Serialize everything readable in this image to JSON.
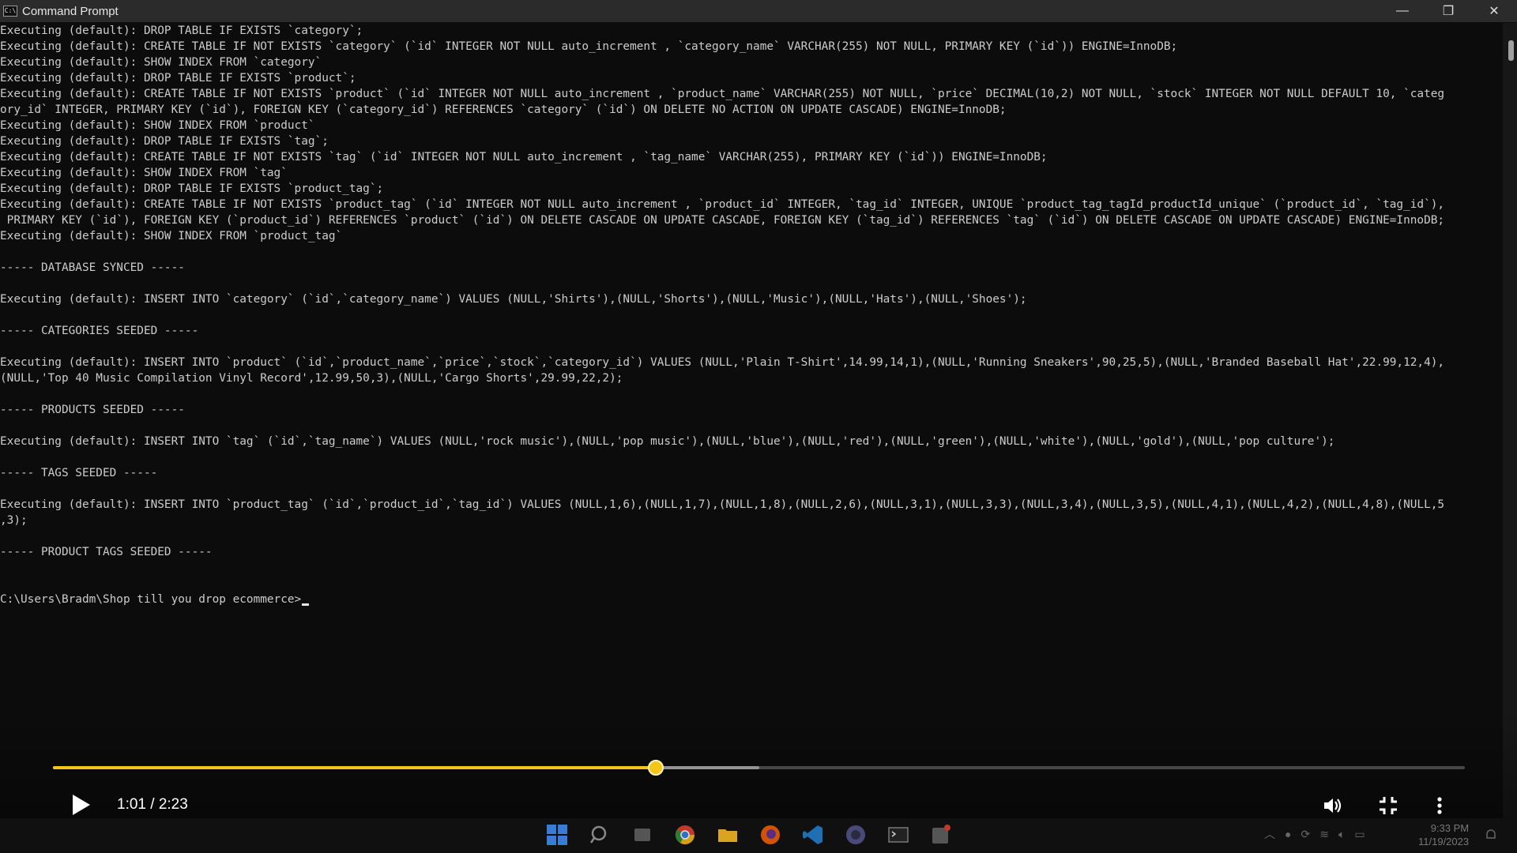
{
  "window": {
    "title": "Command Prompt",
    "icon_text": "C:\\",
    "controls": {
      "minimize": "—",
      "restore": "❐",
      "close": "✕"
    }
  },
  "console": {
    "lines": [
      "Executing (default): DROP TABLE IF EXISTS `category`;",
      "Executing (default): CREATE TABLE IF NOT EXISTS `category` (`id` INTEGER NOT NULL auto_increment , `category_name` VARCHAR(255) NOT NULL, PRIMARY KEY (`id`)) ENGINE=InnoDB;",
      "Executing (default): SHOW INDEX FROM `category`",
      "Executing (default): DROP TABLE IF EXISTS `product`;",
      "Executing (default): CREATE TABLE IF NOT EXISTS `product` (`id` INTEGER NOT NULL auto_increment , `product_name` VARCHAR(255) NOT NULL, `price` DECIMAL(10,2) NOT NULL, `stock` INTEGER NOT NULL DEFAULT 10, `categ",
      "ory_id` INTEGER, PRIMARY KEY (`id`), FOREIGN KEY (`category_id`) REFERENCES `category` (`id`) ON DELETE NO ACTION ON UPDATE CASCADE) ENGINE=InnoDB;",
      "Executing (default): SHOW INDEX FROM `product`",
      "Executing (default): DROP TABLE IF EXISTS `tag`;",
      "Executing (default): CREATE TABLE IF NOT EXISTS `tag` (`id` INTEGER NOT NULL auto_increment , `tag_name` VARCHAR(255), PRIMARY KEY (`id`)) ENGINE=InnoDB;",
      "Executing (default): SHOW INDEX FROM `tag`",
      "Executing (default): DROP TABLE IF EXISTS `product_tag`;",
      "Executing (default): CREATE TABLE IF NOT EXISTS `product_tag` (`id` INTEGER NOT NULL auto_increment , `product_id` INTEGER, `tag_id` INTEGER, UNIQUE `product_tag_tagId_productId_unique` (`product_id`, `tag_id`),",
      " PRIMARY KEY (`id`), FOREIGN KEY (`product_id`) REFERENCES `product` (`id`) ON DELETE CASCADE ON UPDATE CASCADE, FOREIGN KEY (`tag_id`) REFERENCES `tag` (`id`) ON DELETE CASCADE ON UPDATE CASCADE) ENGINE=InnoDB;",
      "Executing (default): SHOW INDEX FROM `product_tag`",
      "",
      "----- DATABASE SYNCED -----",
      "",
      "Executing (default): INSERT INTO `category` (`id`,`category_name`) VALUES (NULL,'Shirts'),(NULL,'Shorts'),(NULL,'Music'),(NULL,'Hats'),(NULL,'Shoes');",
      "",
      "----- CATEGORIES SEEDED -----",
      "",
      "Executing (default): INSERT INTO `product` (`id`,`product_name`,`price`,`stock`,`category_id`) VALUES (NULL,'Plain T-Shirt',14.99,14,1),(NULL,'Running Sneakers',90,25,5),(NULL,'Branded Baseball Hat',22.99,12,4),",
      "(NULL,'Top 40 Music Compilation Vinyl Record',12.99,50,3),(NULL,'Cargo Shorts',29.99,22,2);",
      "",
      "----- PRODUCTS SEEDED -----",
      "",
      "Executing (default): INSERT INTO `tag` (`id`,`tag_name`) VALUES (NULL,'rock music'),(NULL,'pop music'),(NULL,'blue'),(NULL,'red'),(NULL,'green'),(NULL,'white'),(NULL,'gold'),(NULL,'pop culture');",
      "",
      "----- TAGS SEEDED -----",
      "",
      "Executing (default): INSERT INTO `product_tag` (`id`,`product_id`,`tag_id`) VALUES (NULL,1,6),(NULL,1,7),(NULL,1,8),(NULL,2,6),(NULL,3,1),(NULL,3,3),(NULL,3,4),(NULL,3,5),(NULL,4,1),(NULL,4,2),(NULL,4,8),(NULL,5",
      ",3);",
      "",
      "----- PRODUCT TAGS SEEDED -----",
      "",
      ""
    ],
    "prompt": "C:\\Users\\Bradm\\Shop till you drop ecommerce>"
  },
  "player": {
    "time_label": "1:01 / 2:23",
    "progress_fraction": 0.427,
    "buffered_fraction": 0.5,
    "accent_color": "#f5c518"
  },
  "taskbar": {
    "icons": [
      "start-icon",
      "search-icon",
      "task-view-icon",
      "chrome-icon",
      "file-explorer-icon",
      "firefox-icon",
      "vscode-icon",
      "obs-icon",
      "terminal-icon",
      "app-icon"
    ],
    "clock_time": "9:33 PM",
    "clock_date": "11/19/2023"
  }
}
